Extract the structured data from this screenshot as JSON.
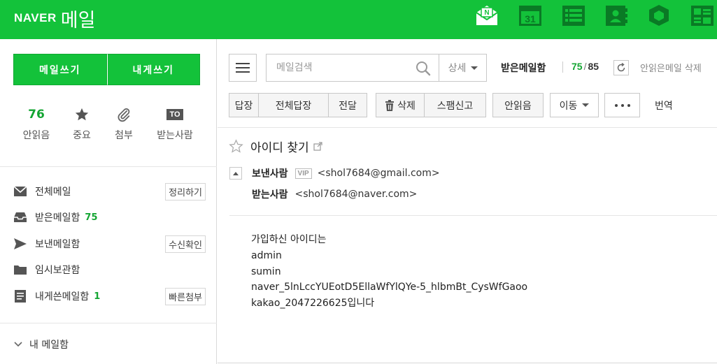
{
  "header": {
    "brand": "NAVER",
    "service": "메일",
    "apps": [
      {
        "name": "mail-app-icon",
        "glyph": "N"
      },
      {
        "name": "calendar-app-icon",
        "glyph": "31"
      },
      {
        "name": "todo-app-icon"
      },
      {
        "name": "contacts-app-icon"
      },
      {
        "name": "mybox-app-icon"
      },
      {
        "name": "memo-app-icon"
      }
    ]
  },
  "sidebar": {
    "write_mail": "메일쓰기",
    "write_self": "내게쓰기",
    "quick": {
      "unread_count": "76",
      "unread_label": "안읽음",
      "important_label": "중요",
      "attach_label": "첨부",
      "to_icon_text": "TO",
      "to_label": "받는사람"
    },
    "folders": [
      {
        "label": "전체메일",
        "count": "",
        "button": "정리하기",
        "icon": "envelope-icon"
      },
      {
        "label": "받은메일함",
        "count": "75",
        "button": "",
        "icon": "inbox-tray-icon"
      },
      {
        "label": "보낸메일함",
        "count": "",
        "button": "수신확인",
        "icon": "send-arrow-icon"
      },
      {
        "label": "임시보관함",
        "count": "",
        "button": "",
        "icon": "folder-icon"
      },
      {
        "label": "내게쓴메일함",
        "count": "1",
        "button": "빠른첨부",
        "icon": "note-icon"
      }
    ],
    "my_mailbox": "내 메일함"
  },
  "search": {
    "placeholder": "메일검색",
    "detail": "상세"
  },
  "mailbox": {
    "title": "받은메일함",
    "unread": "75",
    "separator": "/",
    "total": "85",
    "delete_unread": "안읽은메일 삭제"
  },
  "toolbar": {
    "reply": "답장",
    "reply_all": "전체답장",
    "forward": "전달",
    "delete": "삭제",
    "spam": "스팸신고",
    "mark_unread": "안읽음",
    "move": "이동",
    "translate": "번역"
  },
  "message": {
    "subject": "아이디 찾기",
    "from_label": "보낸사람",
    "vip": "VIP",
    "from": "<shol7684@gmail.com>",
    "to_label": "받는사람",
    "to": "<shol7684@naver.com>",
    "body_lines": [
      "가입하신 아이디는",
      "admin",
      "sumin",
      "naver_5lnLccYUEotD5EllaWfYlQYe-5_hlbmBt_CysWfGaoo",
      "kakao_2047226625입니다"
    ]
  },
  "colors": {
    "brand_green": "#13c23a",
    "count_green": "#13a532"
  }
}
